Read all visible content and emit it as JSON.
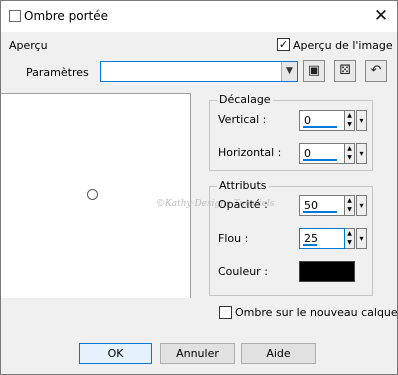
{
  "window": {
    "title": "Ombre portée",
    "close_glyph": "✕"
  },
  "preview": {
    "label": "Aperçu",
    "checkbox_label": "Aperçu de l'image",
    "checkbox_checked": true,
    "watermark": "©Kathy·Designs·Tutoriels"
  },
  "settings": {
    "label": "Paramètres",
    "combo_value": "",
    "icons": [
      "save-preset-icon",
      "randomize-icon",
      "reset-icon"
    ]
  },
  "offset": {
    "title": "Décalage",
    "vertical_label": "Vertical :",
    "vertical_value": "0",
    "horizontal_label": "Horizontal :",
    "horizontal_value": "0"
  },
  "attributes": {
    "title": "Attributs",
    "opacity_label": "Opacité :",
    "opacity_value": "50",
    "blur_label": "Flou :",
    "blur_value": "25",
    "color_label": "Couleur :",
    "color_value": "#000000"
  },
  "new_layer": {
    "label": "Ombre sur le nouveau calque",
    "checked": false
  },
  "buttons": {
    "ok": "OK",
    "cancel": "Annuler",
    "help": "Aide"
  }
}
